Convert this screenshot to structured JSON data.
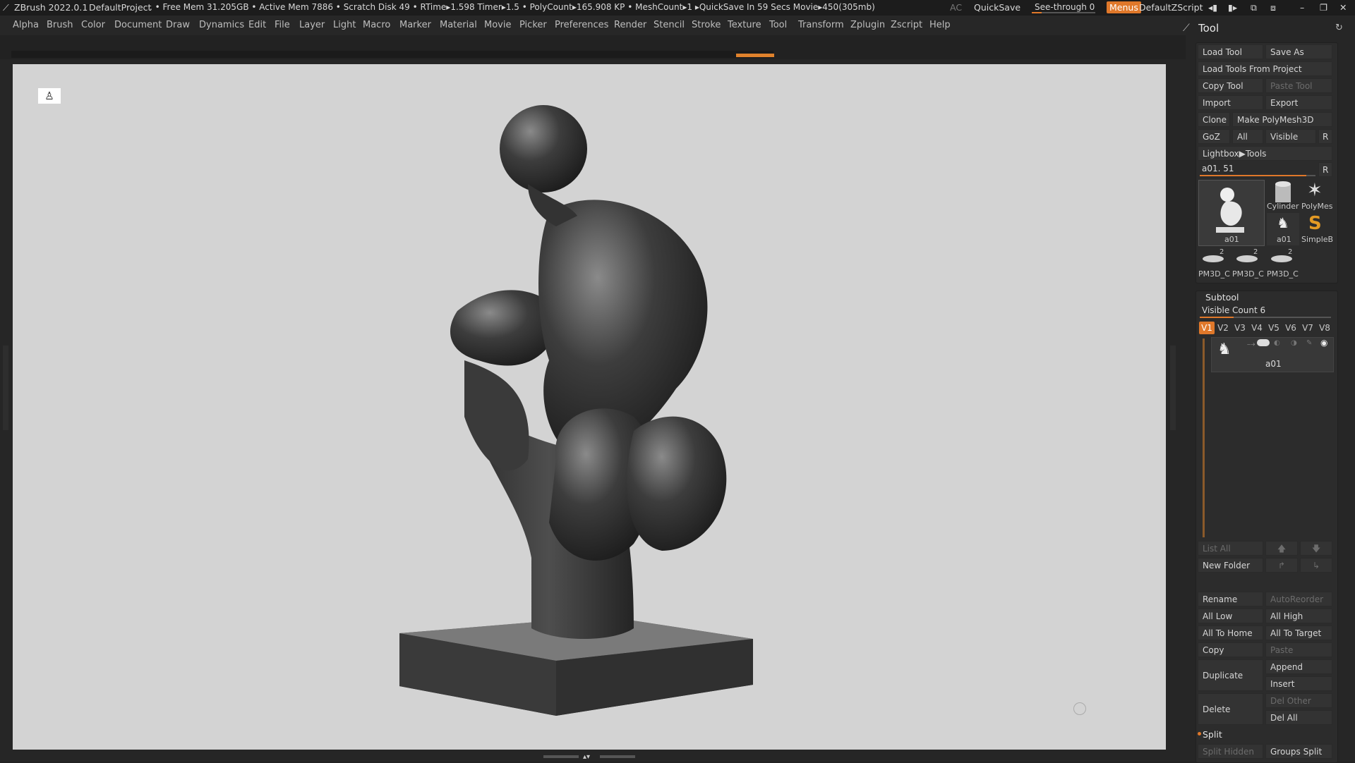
{
  "titlebar": {
    "app": "ZBrush 2022.0.1",
    "project": "DefaultProject",
    "stats": ". • Free Mem 31.205GB • Active Mem 7886 • Scratch Disk 49 •  RTime▸1.598 Timer▸1.5 • PolyCount▸165.908 KP  • MeshCount▸1  ▸QuickSave In 59 Secs Movie▸450(305mb)",
    "ac": "AC",
    "quicksave": "QuickSave",
    "seethrough": "See-through  0",
    "menus": "Menus",
    "zscript": "DefaultZScript"
  },
  "menu_items": [
    "Alpha",
    "Brush",
    "Color",
    "Document",
    "Draw",
    "Dynamics",
    "Edit",
    "File",
    "Layer",
    "Light",
    "Macro",
    "Marker",
    "Material",
    "Movie",
    "Picker",
    "Preferences",
    "Render",
    "Stencil",
    "Stroke",
    "Texture",
    "Tool",
    "Transform",
    "Zplugin",
    "Zscript",
    "Help"
  ],
  "tool_panel": {
    "title": "Tool",
    "load_tool": "Load Tool",
    "save_as": "Save As",
    "load_from_project": "Load Tools From Project",
    "copy_tool": "Copy Tool",
    "paste_tool": "Paste Tool",
    "import": "Import",
    "export": "Export",
    "clone": "Clone",
    "make_polymesh": "Make PolyMesh3D",
    "goz": "GoZ",
    "all": "All",
    "visible": "Visible",
    "r": "R",
    "lightbox_tools": "Lightbox▶Tools",
    "current_tool": "a01. 51",
    "current_tool_slider": 0.92,
    "thumbs": {
      "main": "a01",
      "cylinder": "Cylinder",
      "polymesh": "PolyMes",
      "a01_small": "a01",
      "simpleb": "SimpleB",
      "pm3d_1": "PM3D_C",
      "pm3d_2": "PM3D_C",
      "pm3d_3": "PM3D_C",
      "count": "2"
    }
  },
  "subtool": {
    "title": "Subtool",
    "visible_count": "Visible Count 6",
    "visible_slider": 0.26,
    "tabs": [
      "V1",
      "V2",
      "V3",
      "V4",
      "V5",
      "V6",
      "V7",
      "V8"
    ],
    "active_tab": "V1",
    "item_name": "a01",
    "list_all": "List All",
    "new_folder": "New Folder",
    "rename": "Rename",
    "autoreorder": "AutoReorder",
    "all_low": "All Low",
    "all_high": "All High",
    "all_to_home": "All To Home",
    "all_to_target": "All To Target",
    "copy": "Copy",
    "paste": "Paste",
    "duplicate": "Duplicate",
    "append": "Append",
    "insert": "Insert",
    "delete": "Delete",
    "del_other": "Del Other",
    "del_all": "Del All",
    "split": "Split",
    "split_hidden": "Split Hidden",
    "groups_split": "Groups Split"
  },
  "colors": {
    "accent": "#e0782a",
    "viewport_bg": "#d3d3d3",
    "panel_bg": "#262626"
  }
}
